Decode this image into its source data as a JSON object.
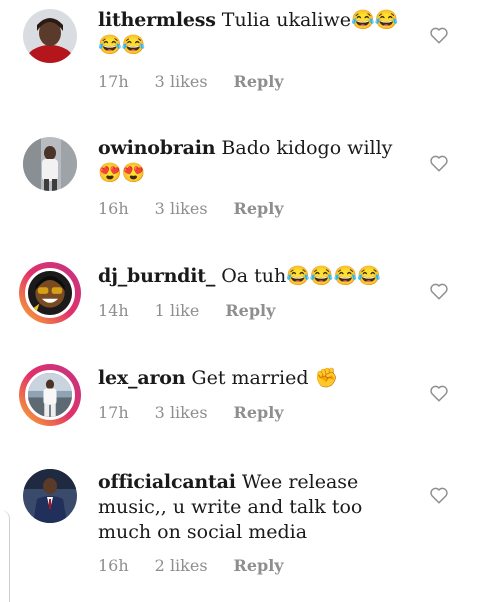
{
  "comments": [
    {
      "username": "lithermless",
      "text": "Tulia ukaliwe😂😂😂😂",
      "time": "17h",
      "likes": "3 likes",
      "reply": "Reply",
      "avatar": "avatar-woman-red",
      "story_ring": false
    },
    {
      "username": "owinobrain",
      "text": "Bado kidogo willy 😍😍",
      "time": "16h",
      "likes": "3 likes",
      "reply": "Reply",
      "avatar": "avatar-man-street",
      "story_ring": false
    },
    {
      "username": "dj_burndit_",
      "text": "Oa tuh😂😂😂😂",
      "time": "14h",
      "likes": "1 like",
      "reply": "Reply",
      "avatar": "avatar-cartoon-sunglasses",
      "story_ring": true
    },
    {
      "username": "lex_aron",
      "text": "Get married ✊",
      "time": "17h",
      "likes": "3 likes",
      "reply": "Reply",
      "avatar": "avatar-man-white-outfit",
      "story_ring": true
    },
    {
      "username": "officialcantai",
      "text": "Wee release music,, u write and talk too much on social media",
      "time": "16h",
      "likes": "2 likes",
      "reply": "Reply",
      "avatar": "avatar-man-suit",
      "story_ring": false
    }
  ],
  "icons": {
    "like": "heart-outline-icon"
  },
  "colors": {
    "meta": "#8e8e8e",
    "ring_start": "#f9b32c",
    "ring_end": "#c13584"
  }
}
